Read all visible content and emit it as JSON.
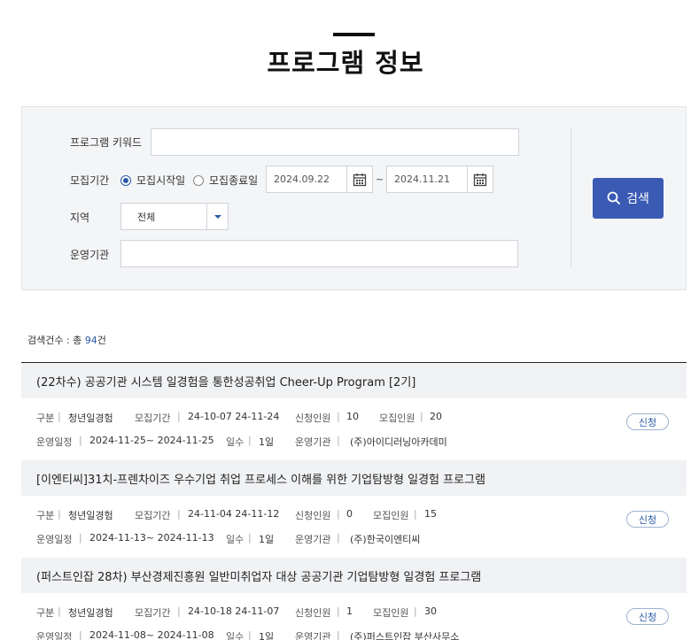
{
  "page": {
    "title": "프로그램 정보"
  },
  "search": {
    "keyword_label": "프로그램 키워드",
    "keyword_value": "",
    "period_label": "모집기간",
    "radio_start": "모집시작일",
    "radio_end": "모집종료일",
    "radio_selected": "모집시작일",
    "date_from": "2024.09.22",
    "date_sep": "~",
    "date_to": "2024.11.21",
    "region_label": "지역",
    "region_value": "전체",
    "org_label": "운영기관",
    "org_value": "",
    "button_label": "검색"
  },
  "results": {
    "count_prefix": "검색건수 : 총 ",
    "count_num": "94",
    "count_suffix": "건"
  },
  "labels": {
    "type": "구분",
    "period": "모집기간",
    "applicants": "신청인원",
    "recruit": "모집인원",
    "schedule": "운영일정",
    "days": "일수",
    "org": "운영기관",
    "apply": "신청",
    "sep": "|"
  },
  "programs": [
    {
      "title": "(22차수) 공공기관 시스템 일경험을 통한성공취업 Cheer-Up Program [2기]",
      "type": "청년일경험",
      "period": "24-10-07 24-11-24",
      "applicants": "10",
      "recruit": "20",
      "schedule": "2024-11-25~ 2024-11-25",
      "days": "1일",
      "org": "(주)아이디러닝아카데미"
    },
    {
      "title": "[이엔티씨]31치-프렌차이즈 우수기업 취업 프로세스 이해를 위한 기업탐방형 일경험 프로그램",
      "type": "청년일경험",
      "period": "24-11-04 24-11-12",
      "applicants": "0",
      "recruit": "15",
      "schedule": "2024-11-13~ 2024-11-13",
      "days": "1일",
      "org": "(주)한국이엔티씨"
    },
    {
      "title": "(퍼스트인잡 28차) 부산경제진흥원 일반미취업자 대상 공공기관 기업탐방형 일경험 프로그램",
      "type": "청년일경험",
      "period": "24-10-18 24-11-07",
      "applicants": "1",
      "recruit": "30",
      "schedule": "2024-11-08~ 2024-11-08",
      "days": "1일",
      "org": "(주)퍼스트인잡 부산사무소"
    }
  ],
  "colors": {
    "accent": "#3a5ab4",
    "link": "#2b5aa8",
    "panel": "#f4f5f7"
  }
}
